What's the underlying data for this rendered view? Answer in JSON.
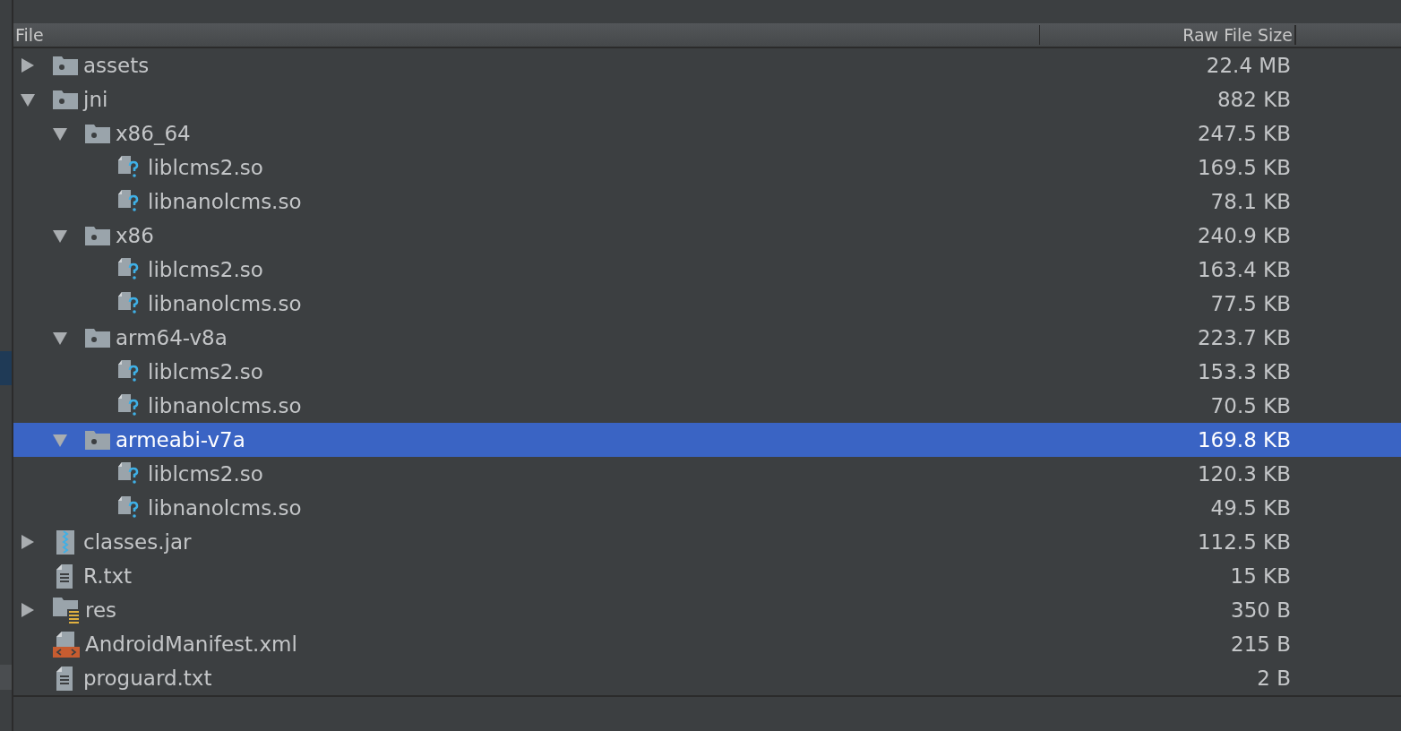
{
  "table": {
    "columns": [
      "File",
      "Raw File Size"
    ],
    "rows": [
      {
        "name": "assets",
        "kind": "folder",
        "size": "22.4 MB",
        "expanded": false,
        "selected": false
      },
      {
        "name": "jni",
        "kind": "folder",
        "size": "882 KB",
        "expanded": true,
        "selected": false,
        "children": [
          {
            "name": "x86_64",
            "kind": "folder",
            "size": "247.5 KB",
            "expanded": true,
            "selected": false,
            "children": [
              {
                "name": "liblcms2.so",
                "kind": "library",
                "size": "169.5 KB",
                "selected": false
              },
              {
                "name": "libnanolcms.so",
                "kind": "library",
                "size": "78.1 KB",
                "selected": false
              }
            ]
          },
          {
            "name": "x86",
            "kind": "folder",
            "size": "240.9 KB",
            "expanded": true,
            "selected": false,
            "children": [
              {
                "name": "liblcms2.so",
                "kind": "library",
                "size": "163.4 KB",
                "selected": false
              },
              {
                "name": "libnanolcms.so",
                "kind": "library",
                "size": "77.5 KB",
                "selected": false
              }
            ]
          },
          {
            "name": "arm64-v8a",
            "kind": "folder",
            "size": "223.7 KB",
            "expanded": true,
            "selected": false,
            "children": [
              {
                "name": "liblcms2.so",
                "kind": "library",
                "size": "153.3 KB",
                "selected": false
              },
              {
                "name": "libnanolcms.so",
                "kind": "library",
                "size": "70.5 KB",
                "selected": false
              }
            ]
          },
          {
            "name": "armeabi-v7a",
            "kind": "folder",
            "size": "169.8 KB",
            "expanded": true,
            "selected": true,
            "children": [
              {
                "name": "liblcms2.so",
                "kind": "library",
                "size": "120.3 KB",
                "selected": false
              },
              {
                "name": "libnanolcms.so",
                "kind": "library",
                "size": "49.5 KB",
                "selected": false
              }
            ]
          }
        ]
      },
      {
        "name": "classes.jar",
        "kind": "jar",
        "size": "112.5 KB",
        "expanded": false,
        "selected": false
      },
      {
        "name": "R.txt",
        "kind": "text",
        "size": "15 KB",
        "selected": false
      },
      {
        "name": "res",
        "kind": "resources",
        "size": "350 B",
        "expanded": false,
        "selected": false
      },
      {
        "name": "AndroidManifest.xml",
        "kind": "xml",
        "size": "215 B",
        "selected": false
      },
      {
        "name": "proguard.txt",
        "kind": "text",
        "size": "2 B",
        "selected": false
      }
    ]
  }
}
